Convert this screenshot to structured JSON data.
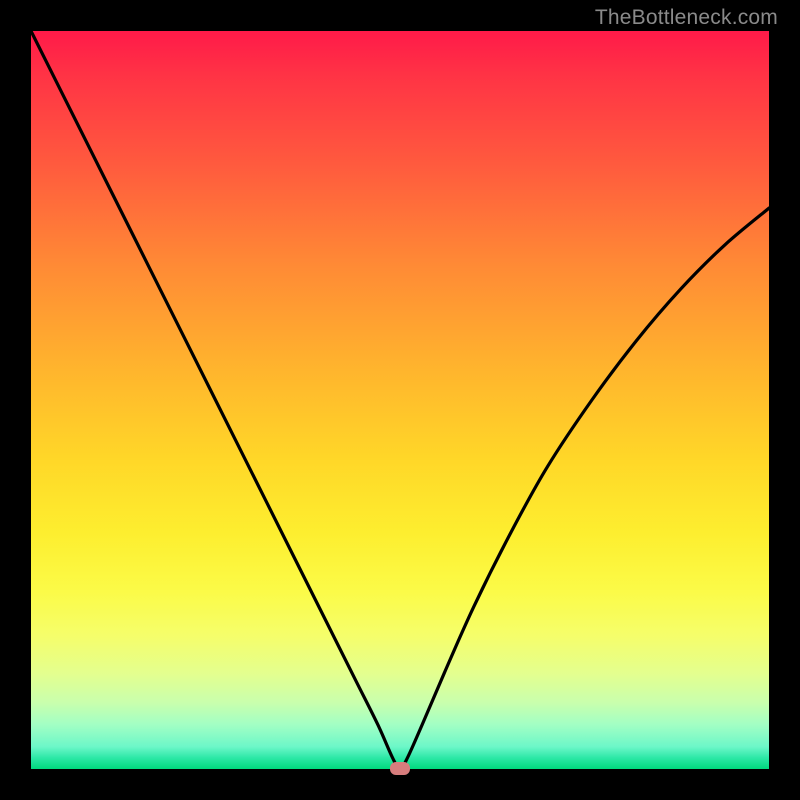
{
  "attribution": "TheBottleneck.com",
  "chart_data": {
    "type": "line",
    "title": "",
    "xlabel": "",
    "ylabel": "",
    "xlim": [
      0,
      100
    ],
    "ylim": [
      0,
      100
    ],
    "background_gradient": {
      "top": "#ff1a49",
      "bottom": "#00d97d"
    },
    "series": [
      {
        "name": "bottleneck-curve",
        "x": [
          0,
          4,
          8,
          12,
          16,
          20,
          24,
          28,
          32,
          36,
          40,
          44,
          47,
          49,
          50,
          51,
          53,
          56,
          60,
          65,
          70,
          76,
          82,
          88,
          94,
          100
        ],
        "y": [
          100,
          92,
          84,
          76,
          68,
          60,
          52,
          44,
          36,
          28,
          20,
          12,
          6,
          1.5,
          0,
          1.5,
          6,
          13,
          22,
          32,
          41,
          50,
          58,
          65,
          71,
          76
        ]
      }
    ],
    "marker": {
      "x": 50,
      "y": 0,
      "color": "#d77d7d"
    }
  }
}
